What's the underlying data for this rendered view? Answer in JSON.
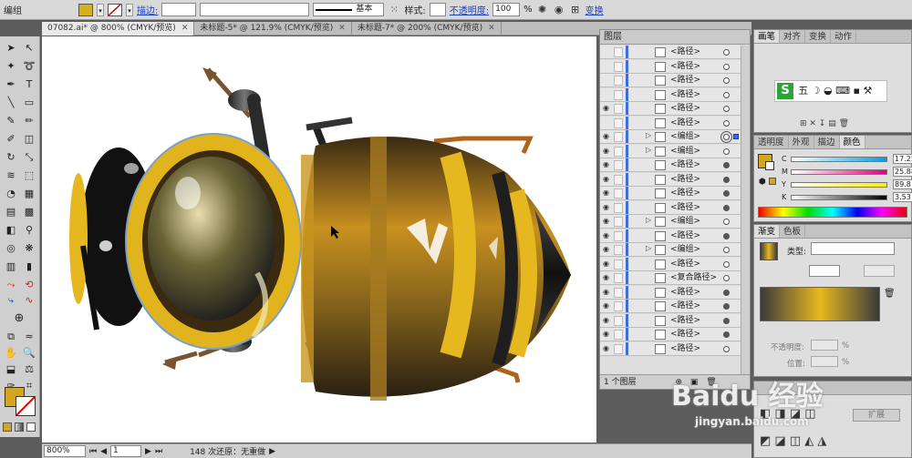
{
  "control_bar": {
    "selection_label": "编组",
    "fill_color": "#d4b21c",
    "stroke_label": "描边:",
    "stroke_profile": "基本",
    "style_label": "样式:",
    "opacity_label": "不透明度:",
    "opacity_value": "100",
    "opacity_unit": "%",
    "transform_label": "变换"
  },
  "doc_tabs": [
    {
      "label": "07082.ai* @ 800% (CMYK/预览)",
      "active": true
    },
    {
      "label": "未标题-5* @ 121.9% (CMYK/预览)",
      "active": false
    },
    {
      "label": "未标题-7* @ 200% (CMYK/预览)",
      "active": false
    }
  ],
  "status_bar": {
    "zoom": "800%",
    "page": "1",
    "undo_text": "148 次还原：无重做"
  },
  "layers_panel": {
    "title": "图层",
    "footer": "1 个图层",
    "rows": [
      {
        "name": "<路径>",
        "type": "path",
        "eye": false,
        "target": "empty",
        "twirl": false
      },
      {
        "name": "<路径>",
        "type": "path",
        "eye": false,
        "target": "empty",
        "twirl": false
      },
      {
        "name": "<路径>",
        "type": "path",
        "eye": false,
        "target": "empty",
        "twirl": false
      },
      {
        "name": "<路径>",
        "type": "path",
        "eye": false,
        "target": "empty",
        "twirl": false
      },
      {
        "name": "<路径>",
        "type": "path",
        "eye": true,
        "target": "empty",
        "twirl": false
      },
      {
        "name": "<路径>",
        "type": "path",
        "eye": false,
        "target": "empty",
        "twirl": false
      },
      {
        "name": "<编组>",
        "type": "group",
        "eye": true,
        "target": "double",
        "twirl": true,
        "selected": true
      },
      {
        "name": "<编组>",
        "type": "group",
        "eye": true,
        "target": "empty",
        "twirl": true
      },
      {
        "name": "<路径>",
        "type": "path",
        "eye": true,
        "target": "filled",
        "twirl": false
      },
      {
        "name": "<路径>",
        "type": "path",
        "eye": true,
        "target": "filled",
        "twirl": false
      },
      {
        "name": "<路径>",
        "type": "path",
        "eye": true,
        "target": "filled",
        "twirl": false
      },
      {
        "name": "<路径>",
        "type": "path",
        "eye": true,
        "target": "filled",
        "twirl": false
      },
      {
        "name": "<编组>",
        "type": "group",
        "eye": true,
        "target": "empty",
        "twirl": true
      },
      {
        "name": "<路径>",
        "type": "path",
        "eye": true,
        "target": "filled",
        "twirl": false
      },
      {
        "name": "<编组>",
        "type": "group",
        "eye": true,
        "target": "empty",
        "twirl": true
      },
      {
        "name": "<路径>",
        "type": "path",
        "eye": true,
        "target": "empty",
        "twirl": false
      },
      {
        "name": "<复合路径>",
        "type": "path",
        "eye": true,
        "target": "empty",
        "twirl": false
      },
      {
        "name": "<路径>",
        "type": "path",
        "eye": true,
        "target": "filled",
        "twirl": false
      },
      {
        "name": "<路径>",
        "type": "path",
        "eye": true,
        "target": "filled",
        "twirl": false
      },
      {
        "name": "<路径>",
        "type": "path",
        "eye": true,
        "target": "filled",
        "twirl": false
      },
      {
        "name": "<路径>",
        "type": "path",
        "eye": true,
        "target": "filled",
        "twirl": false
      },
      {
        "name": "<路径>",
        "type": "path",
        "eye": true,
        "target": "empty",
        "twirl": false
      }
    ]
  },
  "brush_panel": {
    "tabs": [
      "画笔",
      "对齐",
      "变换",
      "动作"
    ]
  },
  "color_panel": {
    "tabs": [
      "透明度",
      "外观",
      "描边",
      "颜色"
    ],
    "channels": [
      {
        "label": "C",
        "value": "17.25",
        "gradient": [
          "#ffffff",
          "#00a0e0"
        ]
      },
      {
        "label": "M",
        "value": "25.88",
        "gradient": [
          "#ffffff",
          "#e0007f"
        ]
      },
      {
        "label": "Y",
        "value": "89.8",
        "gradient": [
          "#ffffff",
          "#ffec00"
        ]
      },
      {
        "label": "K",
        "value": "3.53",
        "gradient": [
          "#ffffff",
          "#000000"
        ]
      }
    ],
    "unit": "%"
  },
  "gradient_panel": {
    "tabs": [
      "渐变",
      "色板"
    ],
    "type_label": "类型:",
    "opacity_label": "不透明度:",
    "location_label": "位置:",
    "pct": "%",
    "stops": [
      "#3a3a3a",
      "#e8b820",
      "#3a3a3a"
    ]
  },
  "pathfinder_label": "扩展",
  "watermark": {
    "brand": "Baidu 经验",
    "url": "jingyan.baidu.com"
  }
}
